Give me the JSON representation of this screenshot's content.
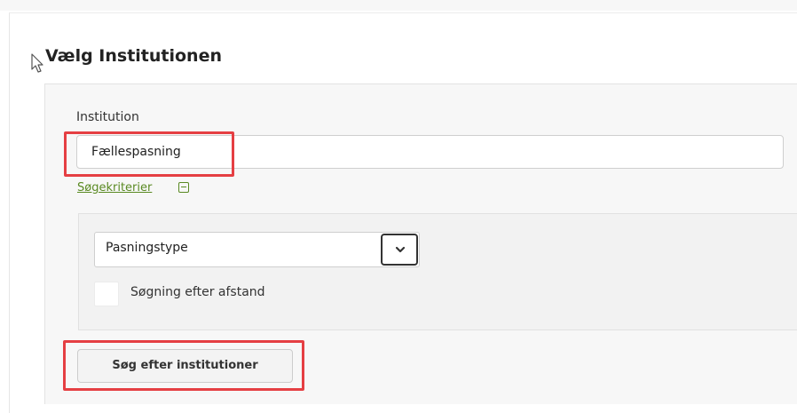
{
  "page": {
    "title": "Vælg Institutionen"
  },
  "institution": {
    "label": "Institution",
    "value": "Fællespasning"
  },
  "criteria": {
    "link_label": "Søgekriterier",
    "toggle_icon": "collapse-minus-icon",
    "type_select": {
      "selected": "Pasningstype",
      "arrow_icon": "chevron-down-icon"
    },
    "distance_checkbox": {
      "label": "Søgning efter afstand",
      "checked": false
    }
  },
  "actions": {
    "search_label": "Søg efter institutioner"
  },
  "colors": {
    "highlight": "#e53f43",
    "link": "#5a8a23"
  }
}
